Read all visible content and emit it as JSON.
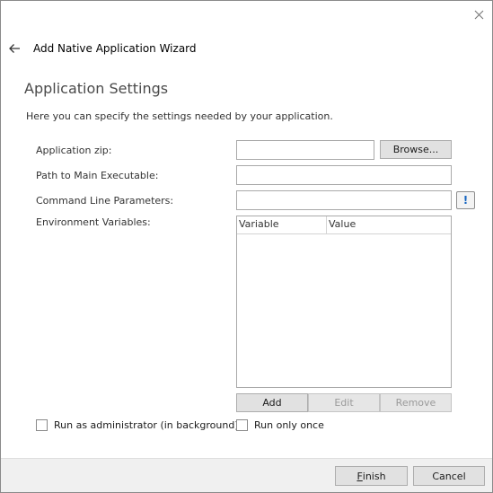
{
  "wizard": {
    "title": "Add Native Application Wizard"
  },
  "page": {
    "section_title": "Application Settings",
    "intro": "Here you can specify the settings needed by your application."
  },
  "form": {
    "app_zip": {
      "label": "Application zip:",
      "value": "",
      "browse_label": "Browse..."
    },
    "main_executable": {
      "label": "Path to Main Executable:",
      "value": ""
    },
    "command_line": {
      "label": "Command Line Parameters:",
      "value": "",
      "hint_glyph": "!"
    },
    "env_vars": {
      "label": "Environment Variables:",
      "columns": [
        "Variable",
        "Value"
      ],
      "rows": [],
      "add_label": "Add",
      "edit_label": "Edit",
      "remove_label": "Remove"
    },
    "run_as_admin": {
      "label": "Run as administrator (in background)",
      "checked": false
    },
    "run_once": {
      "label": "Run only once",
      "checked": false
    }
  },
  "footer": {
    "finish_accel": "F",
    "finish_rest": "inish",
    "cancel_label": "Cancel"
  },
  "icons": {
    "close": "close-icon",
    "back": "arrow-left-icon",
    "warning": "exclamation-icon"
  },
  "colors": {
    "accent": "#1565c0",
    "button_face": "#e1e1e1",
    "footer_bg": "#f0f0f0",
    "section_title": "#4a4a4a"
  }
}
